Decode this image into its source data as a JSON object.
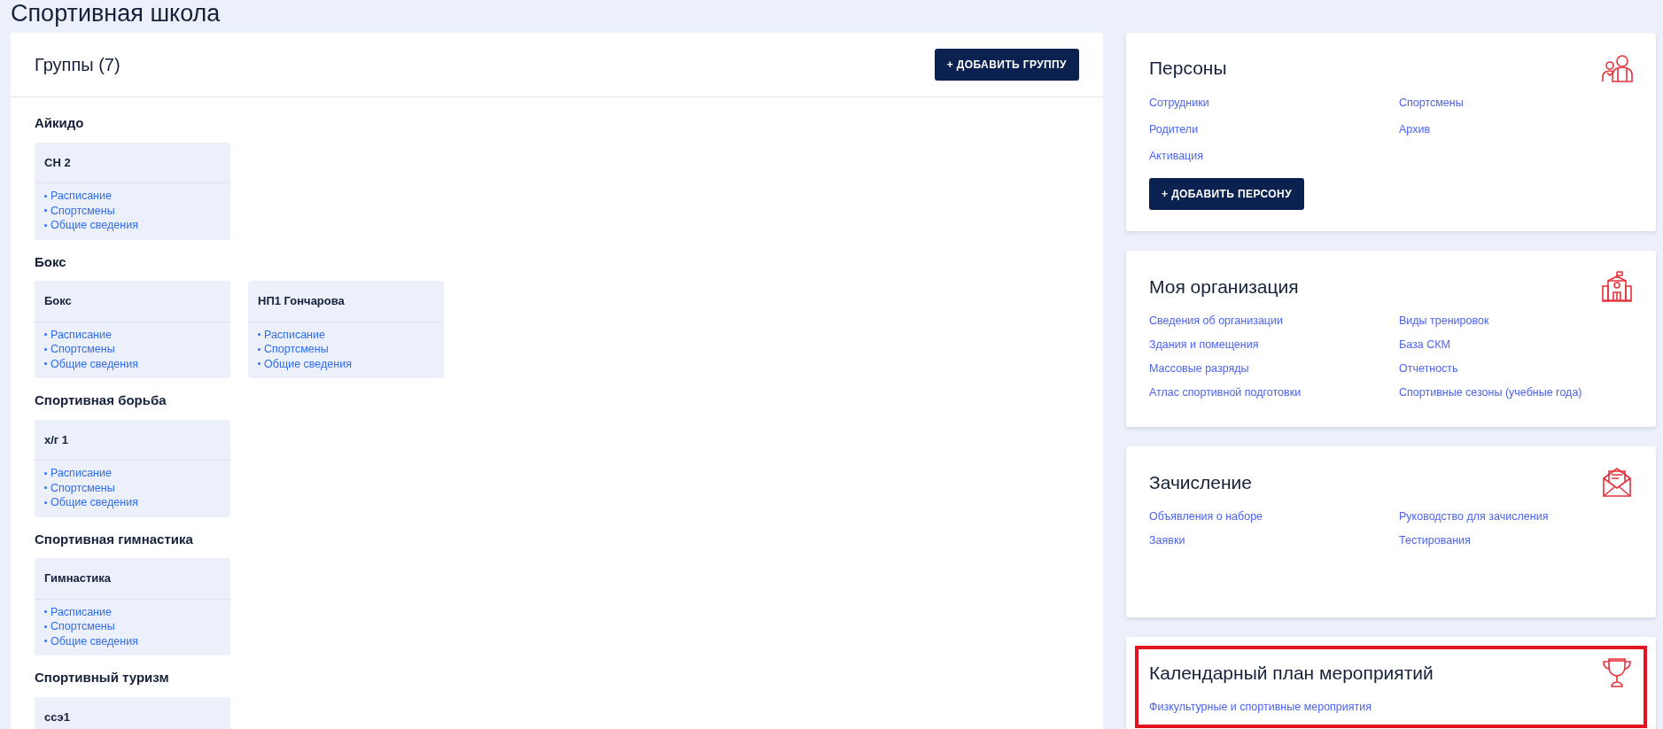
{
  "page_title": "Спортивная школа",
  "groups_panel": {
    "title": "Группы (7)",
    "add_button": "+  ДОБАВИТЬ ГРУППУ",
    "sports": [
      {
        "name": "Айкидо",
        "groups": [
          {
            "name": "СН 2",
            "links": [
              "Расписание",
              "Спортсмены",
              "Общие сведения"
            ]
          }
        ]
      },
      {
        "name": "Бокс",
        "groups": [
          {
            "name": "Бокс",
            "links": [
              "Расписание",
              "Спортсмены",
              "Общие сведения"
            ]
          },
          {
            "name": "НП1 Гончарова",
            "links": [
              "Расписание",
              "Спортсмены",
              "Общие сведения"
            ]
          }
        ]
      },
      {
        "name": "Спортивная борьба",
        "groups": [
          {
            "name": "х/г 1",
            "links": [
              "Расписание",
              "Спортсмены",
              "Общие сведения"
            ]
          }
        ]
      },
      {
        "name": "Спортивная гимнастика",
        "groups": [
          {
            "name": "Гимнастика",
            "links": [
              "Расписание",
              "Спортсмены",
              "Общие сведения"
            ]
          }
        ]
      },
      {
        "name": "Спортивный туризм",
        "groups": [
          {
            "name": "ссэ1"
          }
        ]
      }
    ]
  },
  "sidebar_cards": [
    {
      "title": "Персоны",
      "kind": "people",
      "highlighted": false,
      "links": [
        "Сотрудники",
        "Спортсмены",
        "Родители",
        "Архив",
        "Активация"
      ],
      "button": "+ ДОБАВИТЬ ПЕРСОНУ"
    },
    {
      "title": "Моя организация",
      "kind": "organization",
      "highlighted": false,
      "links": [
        "Сведения об организации",
        "Виды тренировок",
        "Здания и помещения",
        "База СКМ",
        "Массовые разряды",
        "Отчетность",
        "Атлас спортивной подготовки",
        "Спортивные сезоны (учебные года)"
      ]
    },
    {
      "title": "Зачисление",
      "kind": "enrollment",
      "highlighted": false,
      "links": [
        "Объявления о наборе",
        "Руководство для зачисления",
        "Заявки",
        "Тестирования"
      ]
    },
    {
      "title": "Календарный план мероприятий",
      "kind": "events",
      "highlighted": true,
      "links": [
        "Физкультурные и спортивные мероприятия"
      ]
    }
  ]
}
